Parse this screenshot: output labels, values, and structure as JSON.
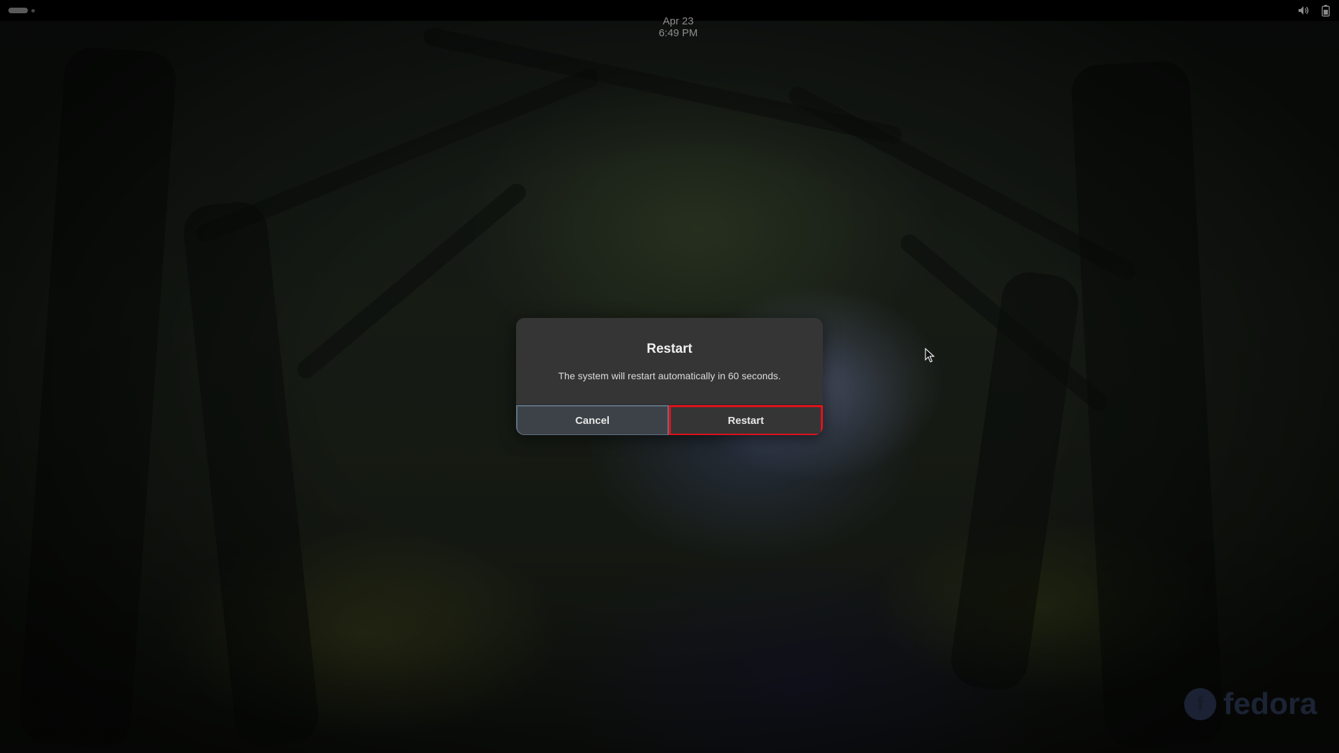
{
  "topbar": {
    "date": "Apr 23",
    "time": "6:49 PM",
    "tray_icons": [
      "volume-icon",
      "battery-icon"
    ]
  },
  "dialog": {
    "title": "Restart",
    "message": "The system will restart automatically in 60 seconds.",
    "cancel_label": "Cancel",
    "restart_label": "Restart"
  },
  "wallpaper": {
    "watermark": "fedora"
  },
  "colors": {
    "highlight": "#e0121b",
    "dialog_bg": "#353535",
    "focus_border": "#5f7184"
  }
}
